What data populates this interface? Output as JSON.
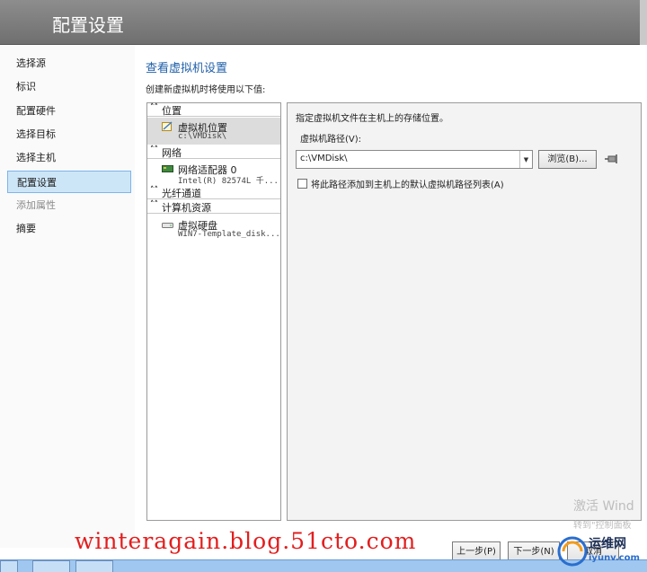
{
  "window": {
    "title": "配置设置"
  },
  "nav": {
    "items": [
      {
        "label": "选择源",
        "state": "normal"
      },
      {
        "label": "标识",
        "state": "normal"
      },
      {
        "label": "配置硬件",
        "state": "normal"
      },
      {
        "label": "选择目标",
        "state": "normal"
      },
      {
        "label": "选择主机",
        "state": "normal"
      },
      {
        "label": "配置设置",
        "state": "selected"
      },
      {
        "label": "添加属性",
        "state": "disabled"
      },
      {
        "label": "摘要",
        "state": "normal"
      }
    ]
  },
  "page": {
    "title": "查看虚拟机设置",
    "subtitle": "创建新虚拟机时将使用以下值:"
  },
  "tree": {
    "sections": [
      {
        "label": "位置",
        "items": [
          {
            "label": "虚拟机位置",
            "value": "c:\\VMDisk\\",
            "icon": "vm-location-icon",
            "selected": true
          }
        ]
      },
      {
        "label": "网络",
        "items": [
          {
            "label": "网络适配器 0",
            "value": "Intel(R) 82574L 千...",
            "icon": "network-adapter-icon",
            "selected": false
          }
        ]
      },
      {
        "label": "光纤通道",
        "items": []
      },
      {
        "label": "计算机资源",
        "items": [
          {
            "label": "虚拟硬盘",
            "value": "WIN7-Template_disk...",
            "icon": "hard-disk-icon",
            "selected": false
          }
        ]
      }
    ]
  },
  "detail": {
    "description": "指定虚拟机文件在主机上的存储位置。",
    "path_label": "虚拟机路径(V):",
    "path_value": "c:\\VMDisk\\",
    "browse_label": "浏览(B)...",
    "checkbox_label": "将此路径添加到主机上的默认虚拟机路径列表(A)",
    "checkbox_checked": false
  },
  "buttons": {
    "previous": "上一步(P)",
    "next": "下一步(N)",
    "cancel": "取消"
  },
  "overlay": {
    "watermark": "winteragain.blog.51cto.com",
    "activate_line1": "激活 Wind",
    "activate_line2": "转到\"控制面板",
    "logo_name": "运维网",
    "logo_url": "iyunv.com"
  },
  "colors": {
    "accent": "#1f5fa8",
    "selection": "#cde6f7",
    "titlebar": "#7a7a7a",
    "watermark": "#e21e1e"
  }
}
